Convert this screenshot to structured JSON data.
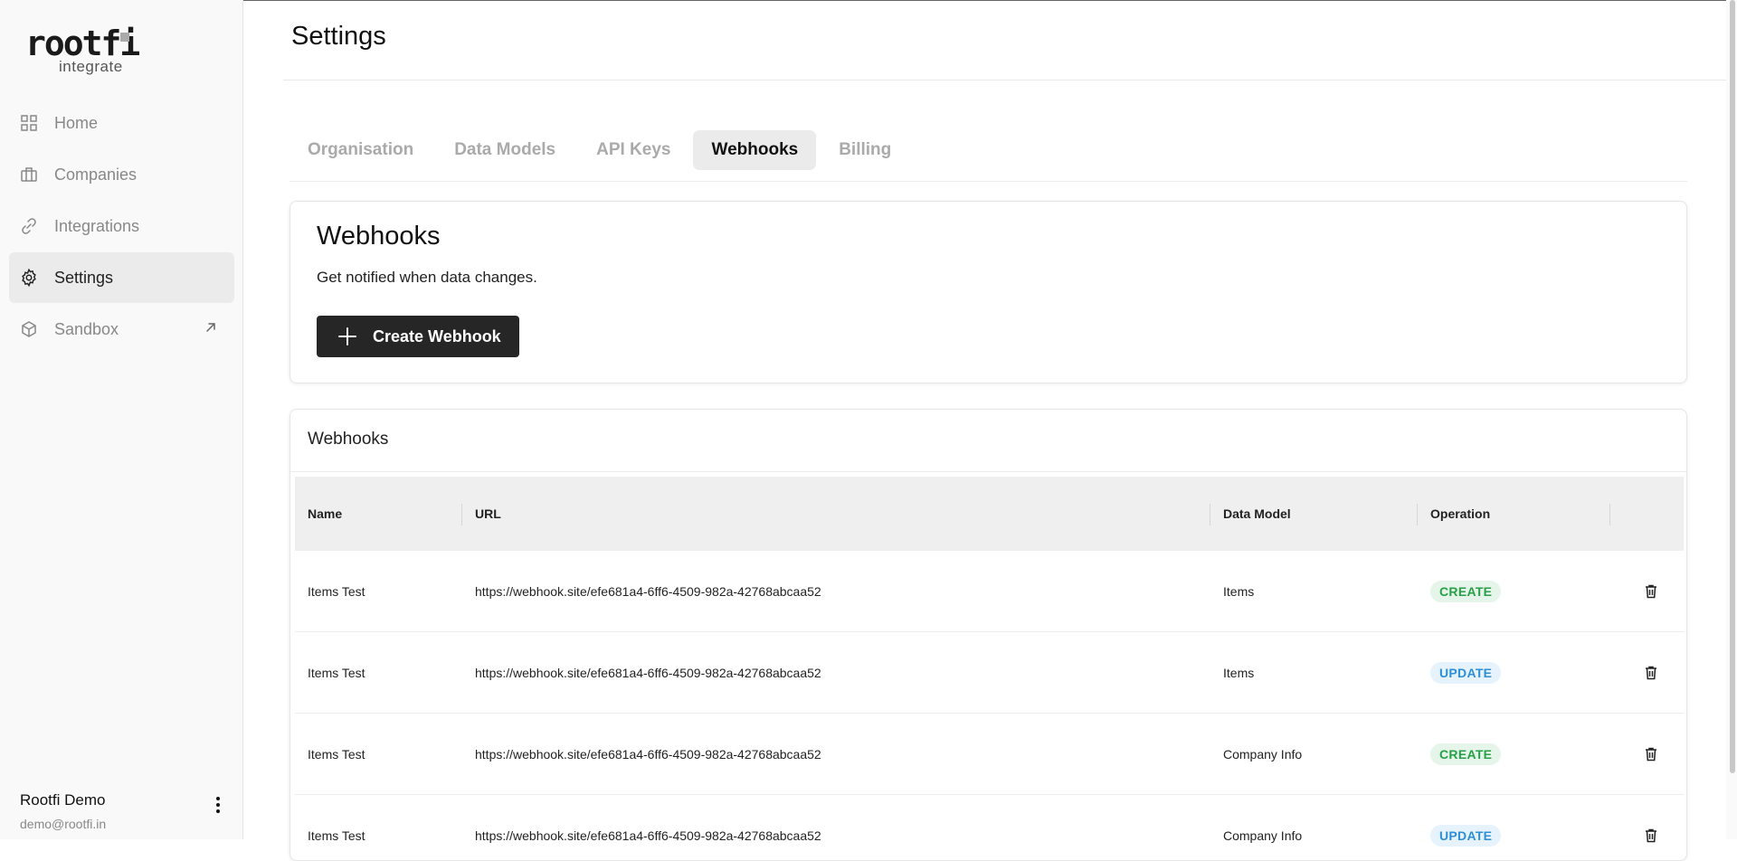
{
  "brand": {
    "name": "rootfi",
    "sub": "integrate"
  },
  "sidebar": {
    "items": [
      {
        "label": "Home",
        "icon": "grid-icon"
      },
      {
        "label": "Companies",
        "icon": "briefcase-icon"
      },
      {
        "label": "Integrations",
        "icon": "link-icon"
      },
      {
        "label": "Settings",
        "icon": "gear-icon",
        "active": true
      },
      {
        "label": "Sandbox",
        "icon": "box-icon",
        "external": true
      }
    ]
  },
  "user": {
    "name": "Rootfi Demo",
    "email": "demo@rootfi.in"
  },
  "page": {
    "title": "Settings"
  },
  "tabs": [
    "Organisation",
    "Data Models",
    "API Keys",
    "Webhooks",
    "Billing"
  ],
  "active_tab": "Webhooks",
  "webhooks_card": {
    "title": "Webhooks",
    "subtitle": "Get notified when data changes.",
    "create_button": "Create Webhook"
  },
  "table": {
    "title": "Webhooks",
    "columns": [
      "Name",
      "URL",
      "Data Model",
      "Operation",
      ""
    ],
    "rows": [
      {
        "name": "Items Test",
        "url": "https://webhook.site/efe681a4-6ff6-4509-982a-42768abcaa52",
        "data_model": "Items",
        "operation": "CREATE"
      },
      {
        "name": "Items Test",
        "url": "https://webhook.site/efe681a4-6ff6-4509-982a-42768abcaa52",
        "data_model": "Items",
        "operation": "UPDATE"
      },
      {
        "name": "Items Test",
        "url": "https://webhook.site/efe681a4-6ff6-4509-982a-42768abcaa52",
        "data_model": "Company Info",
        "operation": "CREATE"
      },
      {
        "name": "Items Test",
        "url": "https://webhook.site/efe681a4-6ff6-4509-982a-42768abcaa52",
        "data_model": "Company Info",
        "operation": "UPDATE"
      }
    ]
  },
  "colors": {
    "create": "#27a048",
    "update": "#2e8fd6",
    "button": "#262626"
  }
}
